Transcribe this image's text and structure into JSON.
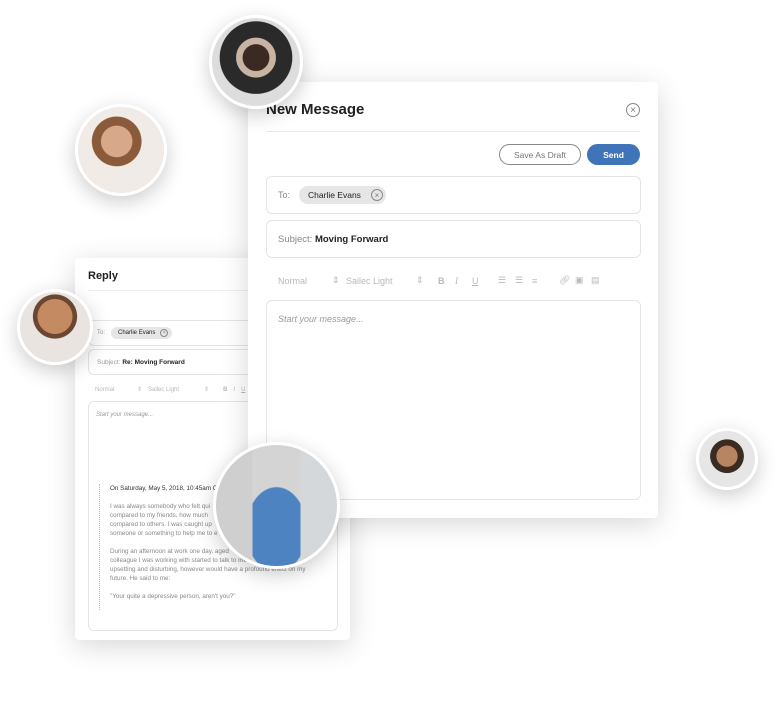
{
  "reply": {
    "title": "Reply",
    "to_label": "To:",
    "recipient": "Charlie Evans",
    "subject_label": "Subject:",
    "subject": "Re: Moving Forward",
    "toolbar": {
      "format": "Normal",
      "font": "Sailec Light",
      "bold": "B",
      "italic": "I",
      "underline": "U"
    },
    "placeholder": "Start your message...",
    "quote_header": "On Saturday, May 5, 2018, 10:45am Ch",
    "quote_lines": [
      "I was always somebody who felt qui",
      "compared to my friends, how much",
      "compared to others. I was caught up",
      "someone or something to help me to e"
    ],
    "quote_lines2": [
      "During an afternoon at work one day, aged",
      "colleague I was working with started to talk to me",
      "upsetting and disturbing, however would have a profound effect on my",
      "future. He said to me:"
    ],
    "quote_end": "\"Your quite a depressive person, aren't you?\""
  },
  "compose": {
    "title": "New Message",
    "save_draft": "Save As Draft",
    "send": "Send",
    "to_label": "To:",
    "recipient": "Charlie Evans",
    "subject_label": "Subject:",
    "subject": "Moving Forward",
    "toolbar": {
      "format": "Normal",
      "font": "Sailec Light",
      "bold": "B",
      "italic": "I",
      "underline": "U"
    },
    "placeholder": "Start your message..."
  },
  "colors": {
    "accent": "#3f74b8"
  }
}
